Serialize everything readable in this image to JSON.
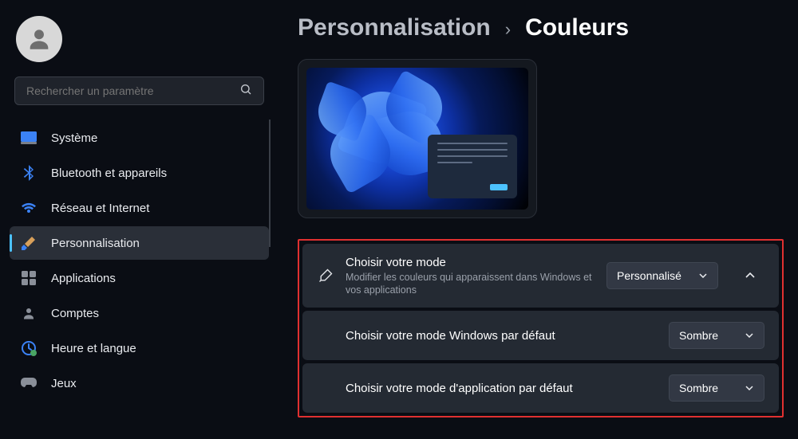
{
  "search": {
    "placeholder": "Rechercher un paramètre"
  },
  "nav": {
    "items": [
      {
        "label": "Système"
      },
      {
        "label": "Bluetooth et appareils"
      },
      {
        "label": "Réseau et Internet"
      },
      {
        "label": "Personnalisation"
      },
      {
        "label": "Applications"
      },
      {
        "label": "Comptes"
      },
      {
        "label": "Heure et langue"
      },
      {
        "label": "Jeux"
      }
    ]
  },
  "breadcrumb": {
    "parent": "Personnalisation",
    "separator": "›",
    "current": "Couleurs"
  },
  "settings": {
    "mode": {
      "title": "Choisir votre mode",
      "desc": "Modifier les couleurs qui apparaissent dans Windows et vos applications",
      "value": "Personnalisé"
    },
    "windowsMode": {
      "title": "Choisir votre mode Windows par défaut",
      "value": "Sombre"
    },
    "appMode": {
      "title": "Choisir votre mode d'application par défaut",
      "value": "Sombre"
    }
  }
}
